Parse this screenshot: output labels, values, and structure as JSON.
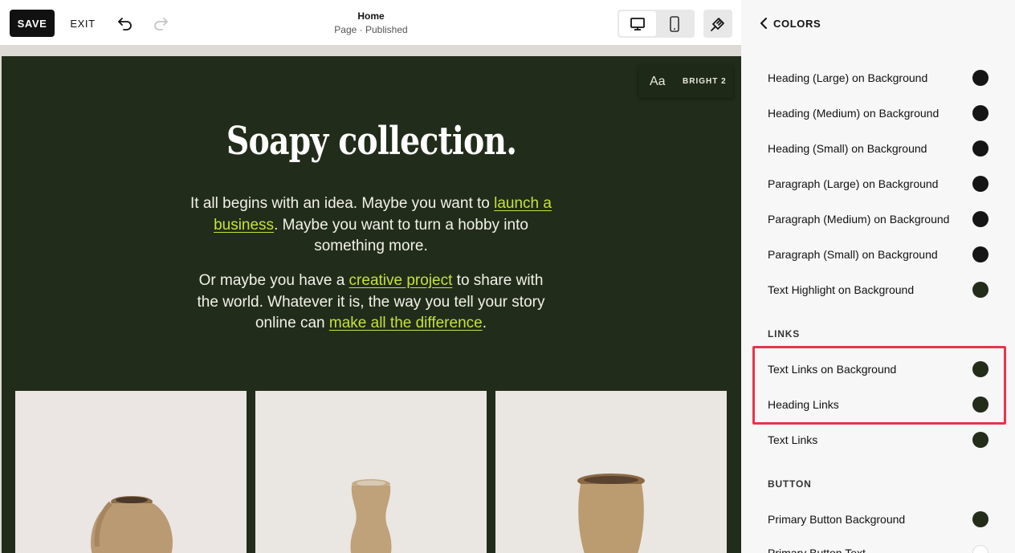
{
  "toolbar": {
    "save_label": "SAVE",
    "exit_label": "EXIT",
    "page_title": "Home",
    "page_status": "Page · Published"
  },
  "canvas": {
    "style_chip": {
      "aa": "Aa",
      "label": "BRIGHT 2"
    },
    "title": "Soapy collection.",
    "para1": {
      "t1": "It all begins with an idea. Maybe you want to ",
      "link1": "launch a business",
      "t2": ". Maybe you want to turn a hobby into something more."
    },
    "para2": {
      "t1": "Or maybe you have a ",
      "link1": "creative project",
      "t2": " to share with the world. Whatever it is, the way you tell your story online can ",
      "link2": "make all the difference",
      "t3": "."
    },
    "colors": {
      "section_bg": "#222c1a",
      "link": "#c4e23a"
    }
  },
  "panel": {
    "title": "COLORS",
    "rows": [
      {
        "label": "Heading (Large) on Background",
        "color": "#151515"
      },
      {
        "label": "Heading (Medium) on Background",
        "color": "#151515"
      },
      {
        "label": "Heading (Small) on Background",
        "color": "#151515"
      },
      {
        "label": "Paragraph (Large) on Background",
        "color": "#151515"
      },
      {
        "label": "Paragraph (Medium) on Background",
        "color": "#151515"
      },
      {
        "label": "Paragraph (Small) on Background",
        "color": "#151515"
      },
      {
        "label": "Text Highlight on Background",
        "color": "#242c1a"
      }
    ],
    "links_section": "LINKS",
    "links_rows": [
      {
        "label": "Text Links on Background",
        "color": "#242c1a"
      },
      {
        "label": "Heading Links",
        "color": "#242c1a"
      },
      {
        "label": "Text Links",
        "color": "#242c1a"
      }
    ],
    "button_section": "BUTTON",
    "button_rows": [
      {
        "label": "Primary Button Background",
        "color": "#242c1a"
      },
      {
        "label": "Primary Button Text",
        "color": "#ffffff"
      }
    ],
    "highlight_color": "#e8354a"
  }
}
